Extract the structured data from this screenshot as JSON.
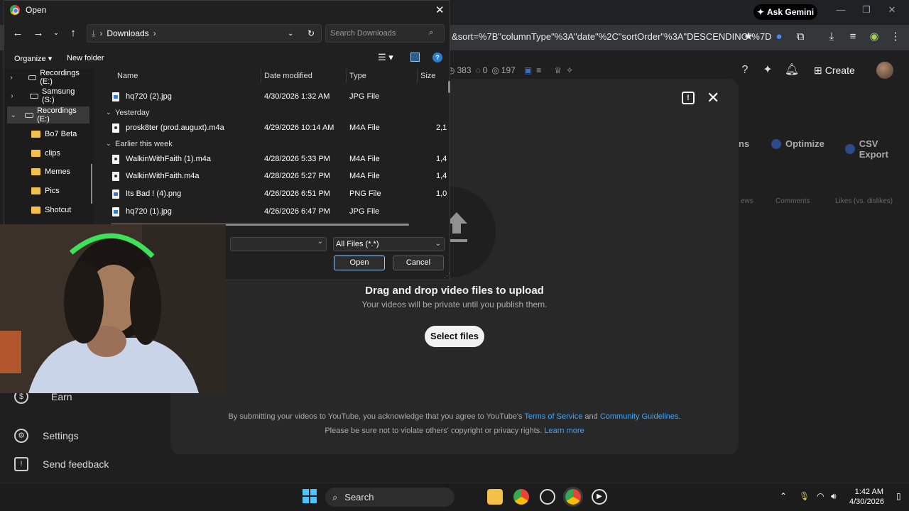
{
  "chrome": {
    "url_fragment": "&sort=%7B\"columnType\"%3A\"date\"%2C\"sortOrder\"%3A\"DESCENDING\"%7D",
    "gemini_label": "Ask Gemini"
  },
  "studio": {
    "stats": {
      "views": "383",
      "comments": "0",
      "subs": "197"
    },
    "create_label": "Create",
    "tabs": {
      "partial": "ns",
      "optimize": "Optimize",
      "csv": "CSV Export"
    },
    "columns": {
      "views": "ews",
      "comments": "Comments",
      "likes": "Likes (vs. dislikes)"
    },
    "sidebar": {
      "earn": "Earn",
      "settings": "Settings",
      "feedback": "Send feedback"
    }
  },
  "upload": {
    "title": "Drag and drop video files to upload",
    "subtitle": "Your videos will be private until you publish them.",
    "select_label": "Select files",
    "terms_pre": "By submitting your videos to YouTube, you acknowledge that you agree to YouTube's",
    "terms_link": "Terms of Service",
    "and": "and",
    "guidelines_link": "Community Guidelines",
    "privacy_text": "Please be sure not to violate others' copyright or privacy rights.",
    "learn_more": "Learn more"
  },
  "dialog": {
    "title": "Open",
    "path": "Downloads",
    "search_placeholder": "Search Downloads",
    "organize": "Organize",
    "new_folder": "New folder",
    "nav": [
      {
        "label": "Recordings (E:)",
        "kind": "drive",
        "chev": ">"
      },
      {
        "label": "Samsung (S:)",
        "kind": "drive",
        "chev": ">"
      },
      {
        "label": "Recordings (E:)",
        "kind": "drive",
        "chev": "v"
      },
      {
        "label": "Bo7 Beta",
        "kind": "folder"
      },
      {
        "label": "clips",
        "kind": "folder"
      },
      {
        "label": "Memes",
        "kind": "folder"
      },
      {
        "label": "Pics",
        "kind": "folder"
      },
      {
        "label": "Shotcut",
        "kind": "folder"
      }
    ],
    "columns": {
      "name": "Name",
      "date": "Date modified",
      "type": "Type",
      "size": "Size"
    },
    "groups": {
      "yesterday": "Yesterday",
      "week": "Earlier this week"
    },
    "files": [
      {
        "name": "hq720 (2).jpg",
        "date": "4/30/2026 1:32 AM",
        "type": "JPG File",
        "size": "",
        "icon": "img"
      },
      {
        "name": "prosk8ter (prod.auguxt).m4a",
        "date": "4/29/2026 10:14 AM",
        "type": "M4A File",
        "size": "2,1",
        "icon": "aud"
      },
      {
        "name": "WalkinWithFaith (1).m4a",
        "date": "4/28/2026 5:33 PM",
        "type": "M4A File",
        "size": "1,4",
        "icon": "aud"
      },
      {
        "name": "WalkinWithFaith.m4a",
        "date": "4/28/2026 5:27 PM",
        "type": "M4A File",
        "size": "1,4",
        "icon": "aud"
      },
      {
        "name": "Its Bad ! (4).png",
        "date": "4/26/2026 6:51 PM",
        "type": "PNG File",
        "size": "1,0",
        "icon": "img"
      },
      {
        "name": "hq720 (1).jpg",
        "date": "4/26/2026 6:47 PM",
        "type": "JPG File",
        "size": "",
        "icon": "img"
      }
    ],
    "filetype": "All Files (*.*)",
    "open_label": "Open",
    "cancel_label": "Cancel"
  },
  "taskbar": {
    "search": "Search",
    "time": "1:42 AM",
    "date": "4/30/2026"
  }
}
